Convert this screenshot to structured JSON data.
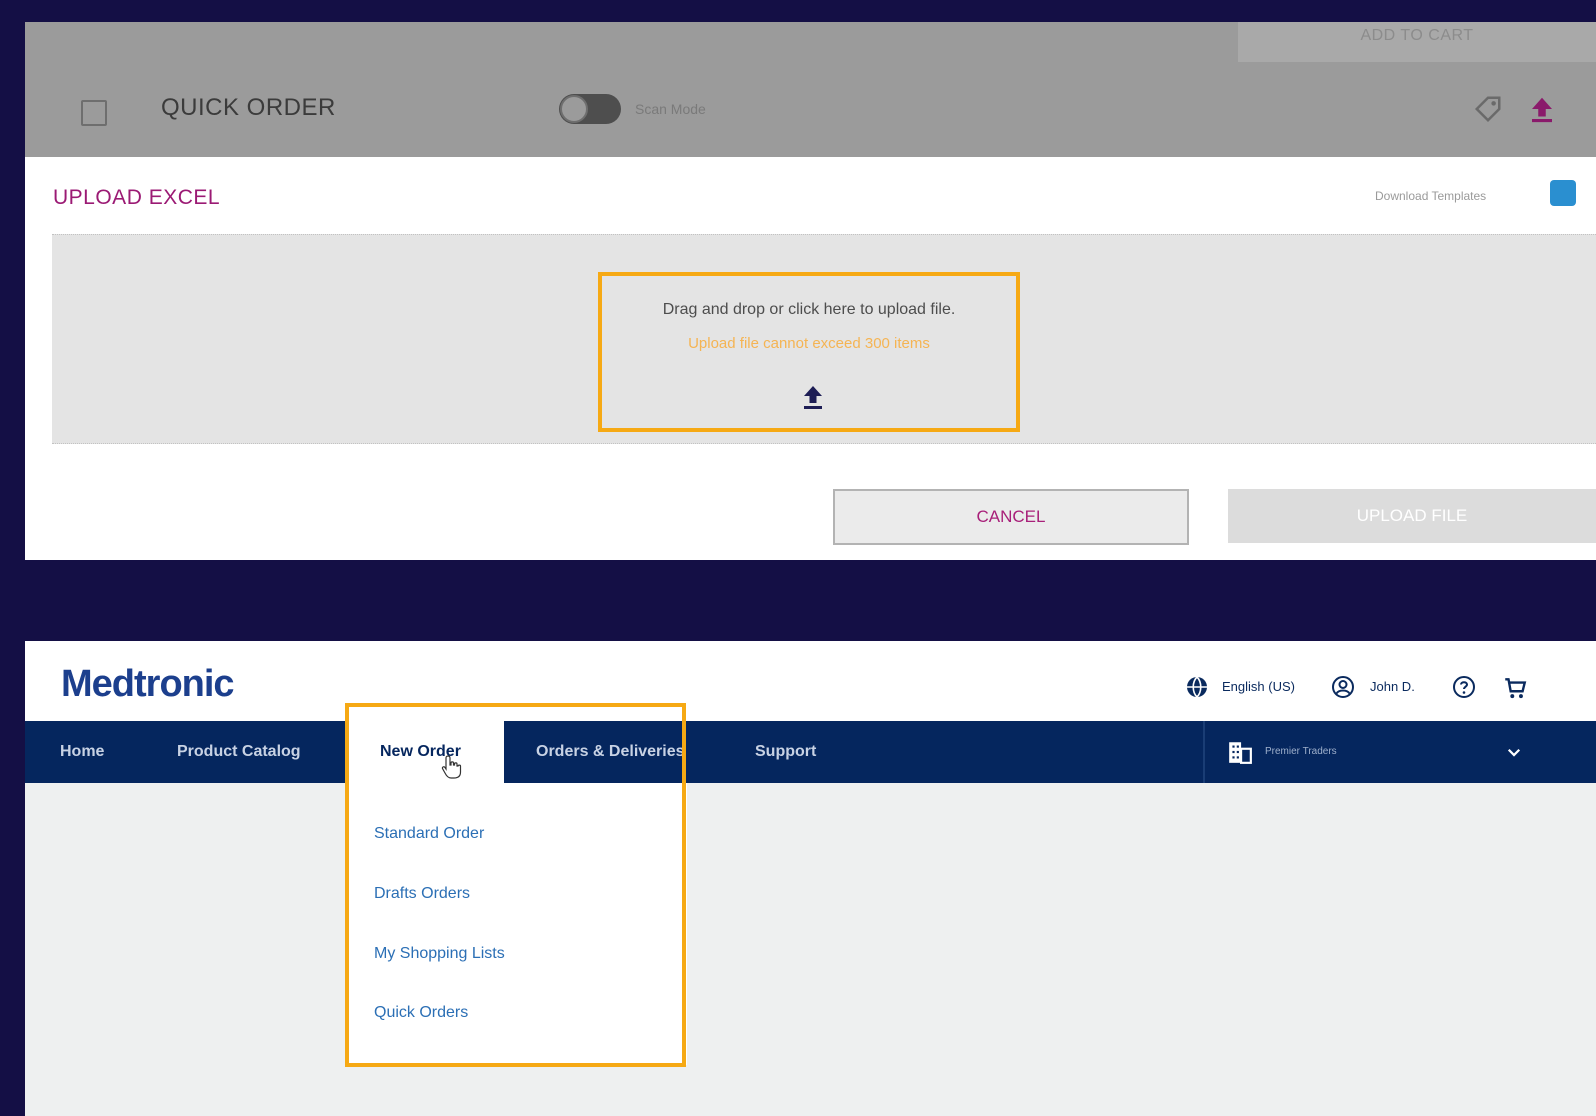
{
  "quick_order": {
    "add_to_cart": "ADD TO CART",
    "title": "QUICK ORDER",
    "scan_mode_label": "Scan Mode",
    "upload_section_title": "UPLOAD EXCEL",
    "download_templates": "Download Templates",
    "dropzone_text": "Drag and drop or click here to upload file.",
    "dropzone_limit": "Upload file cannot exceed 300 items",
    "cancel_label": "CANCEL",
    "upload_file_label": "UPLOAD FILE"
  },
  "header": {
    "logo": "Medtronic",
    "language": "English (US)",
    "user": "John D."
  },
  "nav": {
    "items": [
      "Home",
      "Product Catalog",
      "New Order",
      "Orders & Deliveries",
      "Support"
    ],
    "account": "Premier Traders"
  },
  "new_order_menu": {
    "items": [
      "Standard Order",
      "Drafts Orders",
      "My Shopping Lists",
      "Quick Orders"
    ]
  },
  "colors": {
    "background": "#140f45",
    "highlight": "#f6a914",
    "magenta": "#9b1a74",
    "navy": "#05265e",
    "link_blue": "#2b6fb5"
  }
}
